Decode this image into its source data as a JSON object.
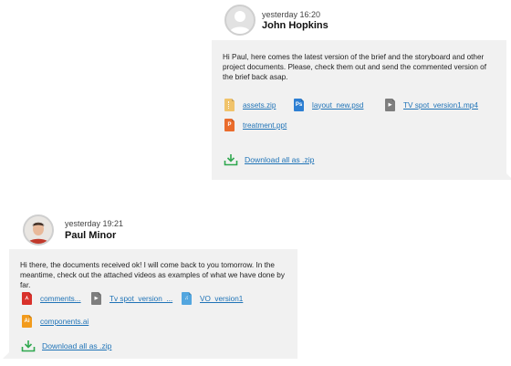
{
  "messages": [
    {
      "time": "yesterday 16:20",
      "author": "John Hopkins",
      "text": "Hi Paul, here comes the latest version of the brief and the storyboard and other project documents. Please, check them out and send the commented version of the brief back asap.",
      "attachments": [
        {
          "name": "assets.zip",
          "icon": "zip-file-icon",
          "color": "#f0c36b",
          "glyph": ""
        },
        {
          "name": "layout_new.psd",
          "icon": "psd-file-icon",
          "color": "#2d7fd3",
          "glyph": "Ps"
        },
        {
          "name": "TV spot_version1.mp4",
          "icon": "video-file-icon",
          "color": "#7e7e7e",
          "glyph": "▶"
        },
        {
          "name": "treatment.ppt",
          "icon": "ppt-file-icon",
          "color": "#ea6c2c",
          "glyph": "P"
        }
      ],
      "download_all": "Download all as .zip"
    },
    {
      "time": "yesterday 19:21",
      "author": "Paul Minor",
      "text": "Hi there, the documents received ok! I will come back to you tomorrow. In the meantime, check out the attached videos as examples of what we have done by far.",
      "attachments": [
        {
          "name": "comments...",
          "icon": "pdf-file-icon",
          "color": "#d9312b",
          "glyph": "⋏"
        },
        {
          "name": "Tv spot_version_...",
          "icon": "video-file-icon",
          "color": "#7e7e7e",
          "glyph": "▶"
        },
        {
          "name": "VO_version1",
          "icon": "audio-file-icon",
          "color": "#53a6df",
          "glyph": "♫"
        },
        {
          "name": "components.ai",
          "icon": "ai-file-icon",
          "color": "#f29b1d",
          "glyph": "Ai"
        }
      ],
      "download_all": "Download all as .zip"
    }
  ],
  "colors": {
    "bubble": "#f1f1f1",
    "link": "#1f73b7",
    "download_icon": "#2fa84f"
  }
}
